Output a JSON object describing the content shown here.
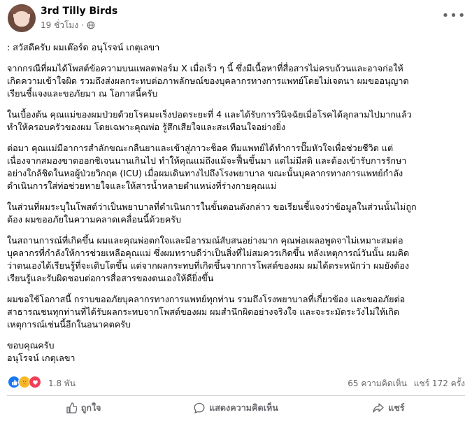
{
  "post": {
    "author": "3rd Tilly Birds",
    "time": "19 ชั่วโมง",
    "time_separator": "·",
    "more_icon": "more-horizontal-icon",
    "privacy_icon": "globe-icon",
    "paragraphs": [
      ": สวัสดีครับ ผมเต๊อร์ด อนุโรจน์ เกตุเลขา",
      "จากกรณีที่ผมได้โพสต์ข้อความบนแพลตฟอร์ม X เมื่อเร็ว ๆ นี้ ซึ่งมีเนื้อหาที่สื่อสารไม่ครบถ้วนและอาจก่อให้\nเกิดความเข้าใจผิด รวมถึงส่งผลกระทบต่อภาพลักษณ์ของบุคลากรทางการแพทย์โดยไม่เจตนา ผมขออนุญาต\nเรียนชี้แจงและขอภัยมา ณ โอกาสนี้ครับ",
      "ในเบื้องต้น คุณแม่ของผมป่วยด้วยโรคมะเร็งปอดระยะที่ 4 และได้รับการวินิจฉัยเมื่อโรคได้ลุกลามไปมากแล้ว\nทำให้ครอบครัวของผม โดยเฉพาะคุณพ่อ รู้สึกเสียใจและสะเทือนใจอย่างยิ่ง",
      "ต่อมา คุณแม่มีอาการสำลักขณะกลืนยาและเข้าสู่ภาวะช็อค ทีมแพทย์ได้ทำการปั๊มหัวใจเพื่อช่วยชีวิต แต่\nเนื่องจากสมองขาดออกซิเจนนานเกินไป ทำให้คุณแม่ถึงแม้จะฟื้นขึ้นมา แต่ไม่มีสติ และต้องเข้ารับการรักษา\nอย่างใกล้ชิดในหอผู้ป่วยวิกฤต (ICU) เมื่อผมเดินทางไปถึงโรงพยาบาล ขณะนั้นบุคลากรทางการแพทย์กำลัง\nดำเนินการใส่ท่อช่วยหายใจและให้สารน้ำหลายตำแหน่งที่ร่างกายคุณแม่",
      "ในส่วนที่ผมระบุในโพสต์ว่าเป็นพยาบาลที่ดำเนินการในขั้นตอนดังกล่าว ขอเรียนชี้แจงว่าข้อมูลในส่วนนั้นไม่ถูก\nต้อง ผมขออภัยในความคลาดเคลื่อนนี้ด้วยครับ",
      "ในสถานการณ์ที่เกิดขึ้น ผมและคุณพ่อตกใจและมีอารมณ์สับสนอย่างมาก คุณพ่อเผลอพูดจาไม่เหมาะสมต่อ\nบุคลากรที่กำลังให้การช่วยเหลือคุณแม่ ซึ่งผมทราบดีว่าเป็นสิ่งที่ไม่สมควรเกิดขึ้น หลังเหตุการณ์วันนั้น ผมคิด\nว่าตนเองได้เรียนรู้ที่จะเติบโตขึ้น แต่จากผลกระทบที่เกิดขึ้นจากการโพสต์ของผม ผมได้ตระหนักว่า ผมยังต้อง\nเรียนรู้และรับผิดชอบต่อการสื่อสารของตนเองให้ดียิ่งขึ้น",
      "ผมขอใช้โอกาสนี้ กราบขออภัยบุคลากรทางการแพทย์ทุกท่าน รวมถึงโรงพยาบาลที่เกี่ยวข้อง และขออภัยต่อ\nสาธารณชนทุกท่านที่ได้รับผลกระทบจากโพสต์ของผม ผมสำนึกผิดอย่างจริงใจ และจะระมัดระวังไม่ให้เกิด\nเหตุการณ์เช่นนี้อีกในอนาคตครับ",
      "ขอบคุณครับ\nอนุโรจน์ เกตุเลขา"
    ]
  },
  "stats": {
    "reaction_count": "1.8 พัน",
    "comments": "65 ความคิดเห็น",
    "shares": "แชร์ 172 ครั้ง",
    "reaction_icons": [
      "like-icon",
      "care-icon",
      "love-icon"
    ]
  },
  "actions": {
    "like": {
      "label": "ถูกใจ",
      "icon": "thumbs-up-icon"
    },
    "comment": {
      "label": "แสดงความคิดเห็น",
      "icon": "comment-icon"
    },
    "share": {
      "label": "แชร์",
      "icon": "share-icon"
    }
  },
  "colors": {
    "text": "#050505",
    "secondary": "#65676b",
    "like_blue": "#1877f2",
    "love_red": "#f33e58",
    "care_yellow": "#f7b928",
    "divider": "#ced0d4"
  }
}
